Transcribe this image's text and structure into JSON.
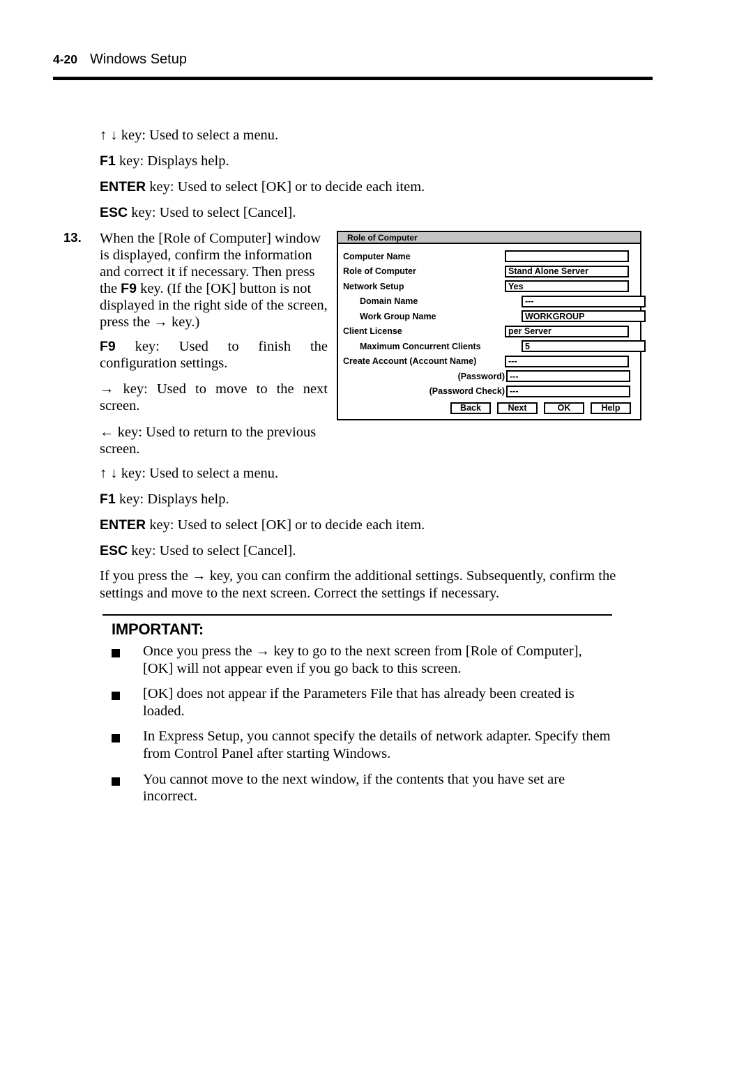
{
  "header": {
    "page_number": "4-20",
    "title": "Windows Setup"
  },
  "key_list_top": [
    {
      "key": "↑ ↓",
      "key_style": "serif",
      "text": " key: Used to select a menu."
    },
    {
      "key": "F1",
      "key_style": "bold",
      "text": " key: Displays help."
    },
    {
      "key": "ENTER",
      "key_style": "bold",
      "text": " key: Used to select [OK] or to decide each item."
    },
    {
      "key": "ESC",
      "key_style": "bold",
      "text": " key: Used to select [Cancel]."
    }
  ],
  "step": {
    "number": "13.",
    "body_before_f9": "When the [Role of Computer] window is displayed, confirm the information and correct it if necessary. Then press the ",
    "f9_label": "F9",
    "body_after_f9": " key. (If the [OK] button is not displayed in the right side of the screen, press the → key.)",
    "f9_desc_key": "F9",
    "f9_desc_text": " key: Used to finish the configuration settings.",
    "right_arrow_key": "→",
    "right_arrow_text": " key: Used to move to the next screen.",
    "left_arrow_key": "←",
    "left_arrow_text": " key: Used to return to the previous screen."
  },
  "key_list_bottom": [
    {
      "key": "↑ ↓",
      "key_style": "serif",
      "text": " key: Used to select a menu."
    },
    {
      "key": "F1",
      "key_style": "bold",
      "text": " key: Displays help."
    },
    {
      "key": "ENTER",
      "key_style": "bold",
      "text": " key: Used to select [OK] or to decide each item."
    },
    {
      "key": "ESC",
      "key_style": "bold",
      "text": " key: Used to select [Cancel]."
    }
  ],
  "paragraph": "If you press the → key, you can confirm the additional settings. Subsequently, confirm the settings and move to the next screen. Correct the settings if necessary.",
  "important": {
    "heading": "IMPORTANT:",
    "bullets": [
      "Once you press the → key to go to the next screen from [Role of Computer], [OK] will not appear even if you go back to this screen.",
      "[OK] does not appear if the Parameters File that has already been created is loaded.",
      "In Express Setup, you cannot specify the details of network adapter. Specify them from Control Panel after starting Windows.",
      "You cannot move to the next window, if the contents that you have set are incorrect."
    ]
  },
  "dialog": {
    "title": "Role of Computer",
    "titlebar_color": "#c4c4c4",
    "fields": [
      {
        "label": "Computer Name",
        "indent": "none",
        "value": ""
      },
      {
        "label": "Role of Computer",
        "indent": "none",
        "value": "Stand Alone Server"
      },
      {
        "label": "Network Setup",
        "indent": "none",
        "value": "Yes"
      },
      {
        "label": "Domain Name",
        "indent": "one",
        "value": "---"
      },
      {
        "label": "Work Group Name",
        "indent": "one",
        "value": "WORKGROUP"
      },
      {
        "label": "Client License",
        "indent": "none",
        "value": "per Server"
      },
      {
        "label": "Maximum Concurrent Clients",
        "indent": "one",
        "value": "5"
      },
      {
        "label": "Create Account (Account Name)",
        "indent": "none",
        "value": "---"
      },
      {
        "label": "(Password)",
        "indent": "right",
        "value": "---"
      },
      {
        "label": "(Password Check)",
        "indent": "right",
        "value": "---"
      }
    ],
    "buttons": [
      {
        "label": "Back"
      },
      {
        "label": "Next"
      },
      {
        "label": "OK"
      },
      {
        "label": "Help"
      }
    ]
  }
}
